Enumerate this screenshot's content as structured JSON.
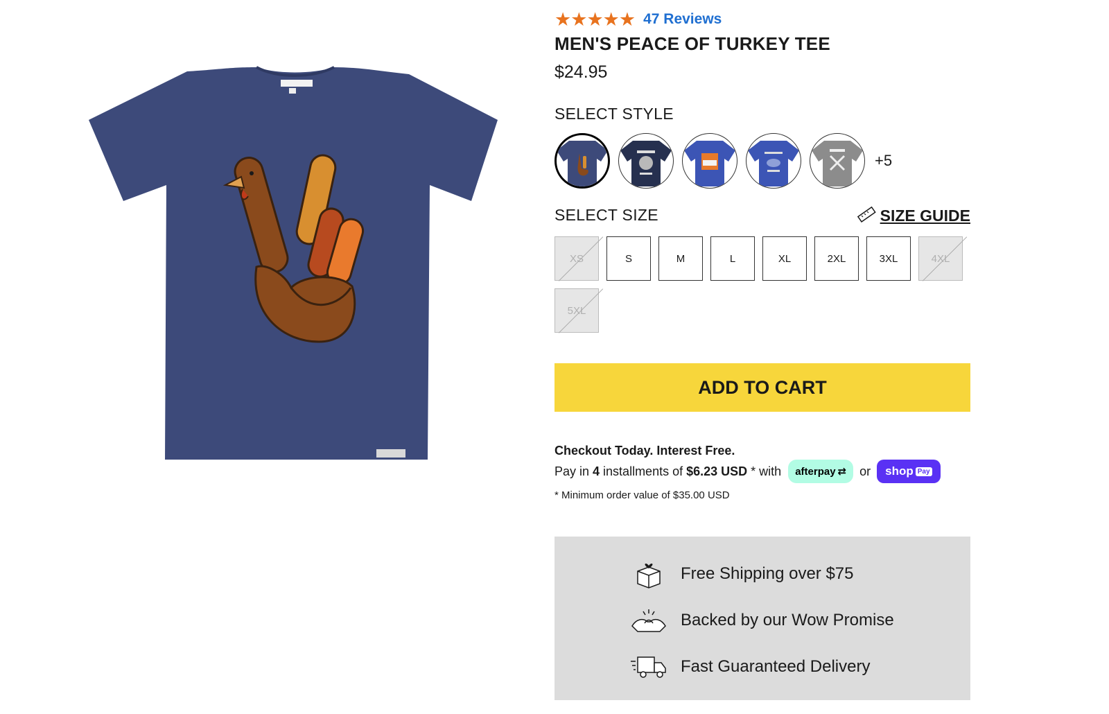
{
  "rating": {
    "stars": 5,
    "reviews": "47 Reviews"
  },
  "product": {
    "title": "MEN'S PEACE OF TURKEY TEE",
    "price": "$24.95",
    "image_icon": "turkey-peace-sign-tshirt"
  },
  "style": {
    "label": "SELECT STYLE",
    "more": "+5",
    "swatch_count": 5
  },
  "size": {
    "label": "SELECT SIZE",
    "guide": "SIZE GUIDE",
    "options": [
      {
        "label": "XS",
        "available": false
      },
      {
        "label": "S",
        "available": true
      },
      {
        "label": "M",
        "available": true
      },
      {
        "label": "L",
        "available": true
      },
      {
        "label": "XL",
        "available": true
      },
      {
        "label": "2XL",
        "available": true
      },
      {
        "label": "3XL",
        "available": true
      },
      {
        "label": "4XL",
        "available": false
      },
      {
        "label": "5XL",
        "available": false
      }
    ]
  },
  "cart": {
    "add_label": "ADD TO CART"
  },
  "checkout": {
    "heading": "Checkout Today. Interest Free.",
    "pay_in": "Pay in",
    "count": "4",
    "installments_of": "installments of",
    "amount": "$6.23 USD",
    "with": "* with",
    "afterpay": "afterpay",
    "or": "or",
    "shoppay": "shop",
    "shoppay_badge": "Pay",
    "minimum": "* Minimum order value of $35.00 USD"
  },
  "promises": [
    {
      "icon": "box-heart-icon",
      "text": "Free Shipping over $75"
    },
    {
      "icon": "pinky-promise-icon",
      "text": "Backed by our Wow Promise"
    },
    {
      "icon": "delivery-truck-icon",
      "text": "Fast Guaranteed Delivery"
    }
  ],
  "colors": {
    "star": "#e8731f",
    "link": "#1f6fd1",
    "cta": "#f7d63b",
    "shirt": "#3d4a7a",
    "afterpay": "#b2fce4",
    "shoppay": "#5a31f4",
    "promise_bg": "#dcdcdc"
  }
}
